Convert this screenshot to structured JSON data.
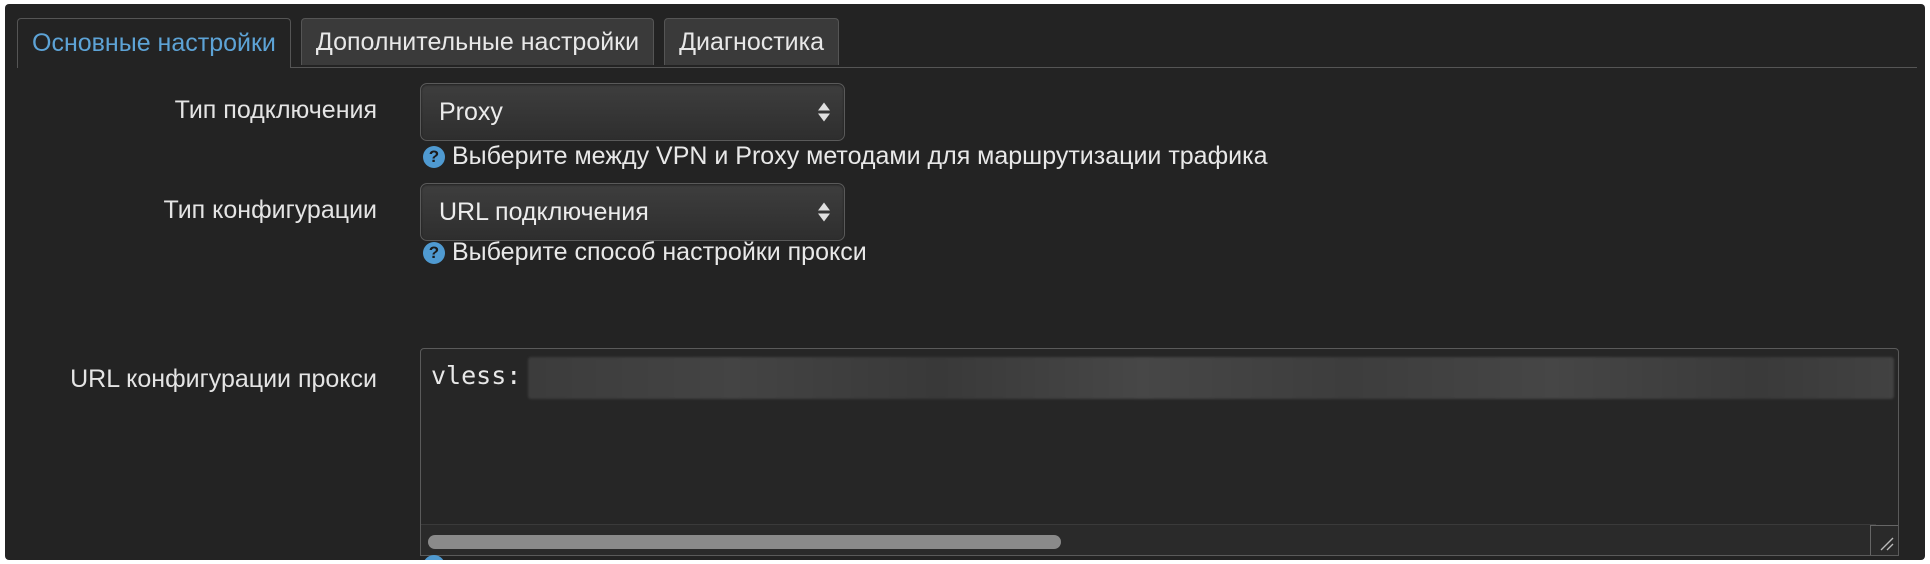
{
  "tabs": [
    {
      "label": "Основные настройки",
      "active": true
    },
    {
      "label": "Дополнительные настройки",
      "active": false
    },
    {
      "label": "Диагностика",
      "active": false
    }
  ],
  "form": {
    "connection_type": {
      "label": "Тип подключения",
      "value": "Proxy",
      "help": "Выберите между VPN и Proxy методами для маршрутизации трафика"
    },
    "config_type": {
      "label": "Тип конфигурации",
      "value": "URL подключения",
      "help": "Выберите способ настройки прокси"
    },
    "proxy_url": {
      "label": "URL конфигурации прокси",
      "value_visible": "vless:"
    }
  },
  "colors": {
    "panel_bg": "#232323",
    "accent": "#5da3d6",
    "help_icon": "#4f9ad1"
  },
  "icons": {
    "help": "question-circle-icon",
    "select_arrows": "updown-arrows-icon",
    "resize": "resize-handle-icon"
  }
}
